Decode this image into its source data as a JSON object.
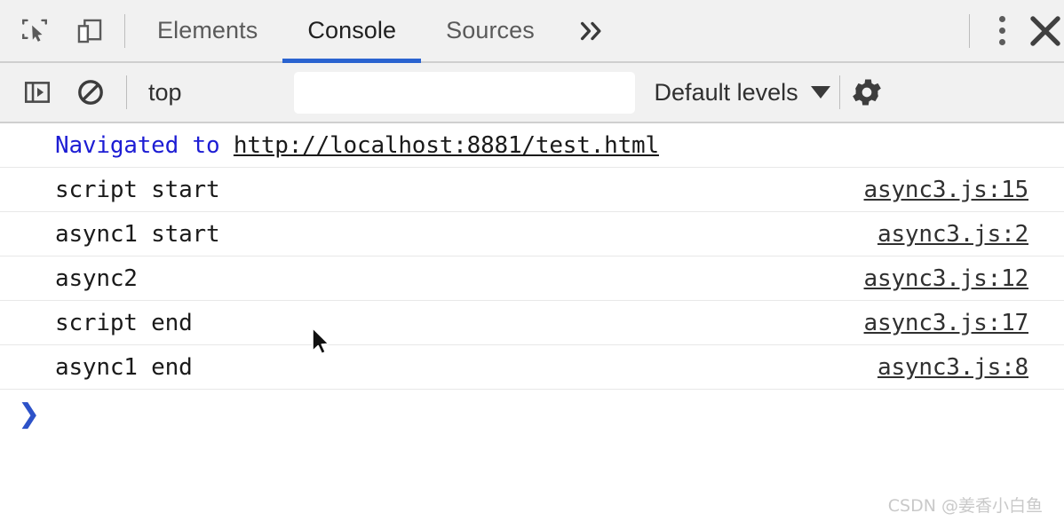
{
  "window": {
    "app": "Chrome DevTools",
    "background": "#ffffff",
    "toolbar_background": "#f1f1f1",
    "accent_color": "#2a63d0"
  },
  "tabbar": {
    "inspect_icon": "inspect-element-icon",
    "device_icon": "device-toolbar-icon",
    "tabs": [
      {
        "label": "Elements",
        "active": false
      },
      {
        "label": "Console",
        "active": true
      },
      {
        "label": "Sources",
        "active": false
      }
    ],
    "more_tabs_label": "»",
    "more_options_icon": "kebab-menu-icon",
    "close_icon": "close-icon"
  },
  "console_toolbar": {
    "sidebar_toggle_icon": "console-sidebar-icon",
    "clear_console_icon": "clear-console-icon",
    "context_selector": "top",
    "filter": {
      "value": "",
      "placeholder": ""
    },
    "log_levels": {
      "label": "Default levels",
      "caret": "chevron-down-icon"
    },
    "settings_icon": "gear-icon"
  },
  "console": {
    "messages": [
      {
        "kind": "navigation",
        "prefix": "Navigated to ",
        "url": "http://localhost:8881/test.html",
        "source": ""
      },
      {
        "kind": "log",
        "text": "script start",
        "source": "async3.js:15"
      },
      {
        "kind": "log",
        "text": "async1 start",
        "source": "async3.js:2"
      },
      {
        "kind": "log",
        "text": "async2",
        "source": "async3.js:12"
      },
      {
        "kind": "log",
        "text": "script end",
        "source": "async3.js:17"
      },
      {
        "kind": "log",
        "text": "async1 end",
        "source": "async3.js:8"
      }
    ],
    "prompt": {
      "chevron": "❯",
      "value": "",
      "placeholder": ""
    }
  },
  "watermark": {
    "text": "CSDN @姜香小白鱼"
  }
}
